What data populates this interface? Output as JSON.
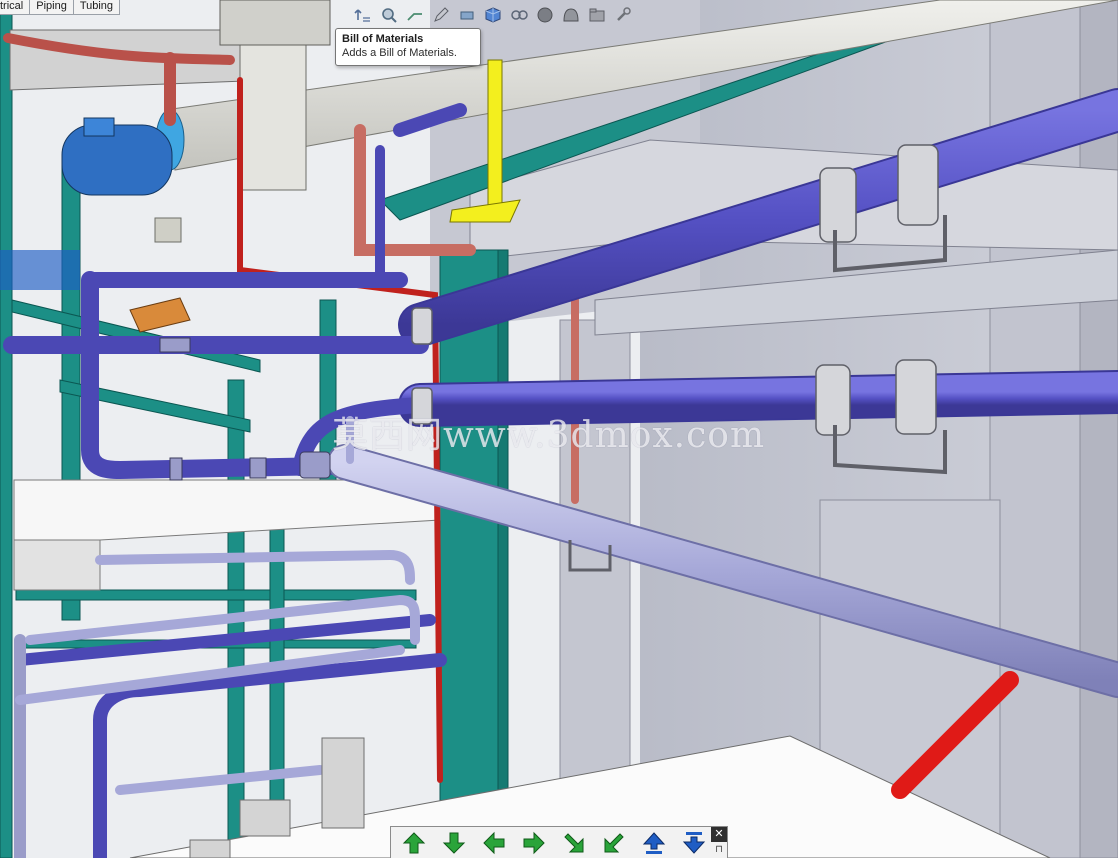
{
  "tabs": [
    {
      "label": "trical"
    },
    {
      "label": "Piping"
    },
    {
      "label": "Tubing"
    }
  ],
  "tooltip": {
    "title": "Bill of Materials",
    "description": "Adds a Bill of Materials."
  },
  "watermark": "莫西网www.3dmox.com",
  "navbar": {
    "buttons": [
      "arrow-up-icon",
      "arrow-down-icon",
      "arrow-left-icon",
      "arrow-right-icon",
      "arrow-down-right-icon",
      "arrow-down-left-icon",
      "arrow-up-blue-icon",
      "arrow-down-blue-icon"
    ],
    "close_label": "✕",
    "pin_label": "⊓"
  },
  "colors": {
    "pipe_blue": "#5a56c8",
    "pipe_light": "#a9aad8",
    "pipe_red": "#c0211d",
    "steel_teal": "#1c8f86",
    "duct_gray": "#d9d9d5",
    "wall_gray": "#c9cbd4",
    "support_yellow": "#f3ef1e",
    "nav_green": "#2aa43a",
    "nav_blue": "#1f5dc4"
  }
}
